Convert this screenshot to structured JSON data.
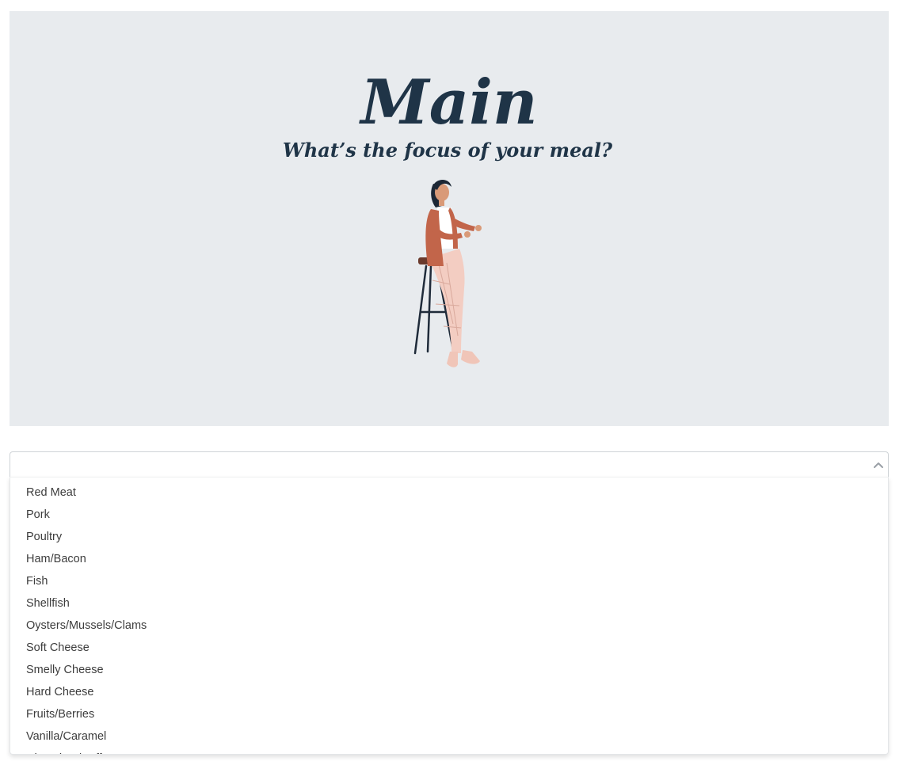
{
  "hero": {
    "title": "Main",
    "subtitle": "What’s the focus of your meal?",
    "background_color": "#e8ebee",
    "title_color": "#1f3447",
    "illustration": "woman-on-stool-illustration"
  },
  "select": {
    "value": "",
    "caret_icon": "chevron-up-icon",
    "options": [
      "Red Meat",
      "Pork",
      "Poultry",
      "Ham/Bacon",
      "Fish",
      "Shellfish",
      "Oysters/Mussels/Clams",
      "Soft Cheese",
      "Smelly Cheese",
      "Hard Cheese",
      "Fruits/Berries",
      "Vanilla/Caramel",
      "Chocolate/Coffee"
    ]
  }
}
